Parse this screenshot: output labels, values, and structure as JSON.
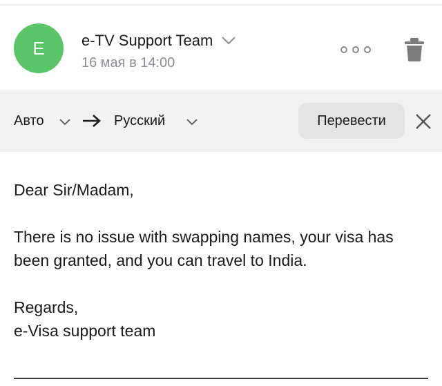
{
  "colors": {
    "avatar_bg": "#5ac566",
    "translate_bar_bg": "#f2f2f2",
    "secondary_text": "#8e8e93"
  },
  "header": {
    "avatar_letter": "E",
    "sender_name": "e-TV Support Team",
    "date": "16 мая в 14:00",
    "icons": [
      "chevron-down-icon",
      "more-icon",
      "trash-icon"
    ]
  },
  "translate_bar": {
    "source_lang": "Авто",
    "target_lang": "Русский",
    "translate_label": "Перевести",
    "icons": [
      "chevron-down-icon",
      "arrow-right-icon",
      "close-icon"
    ]
  },
  "message": {
    "greeting": "Dear Sir/Madam,",
    "paragraph": "There is no issue with swapping names, your visa has been granted, and you can travel to India.",
    "closing": "Regards,",
    "signature": "e-Visa support team"
  }
}
